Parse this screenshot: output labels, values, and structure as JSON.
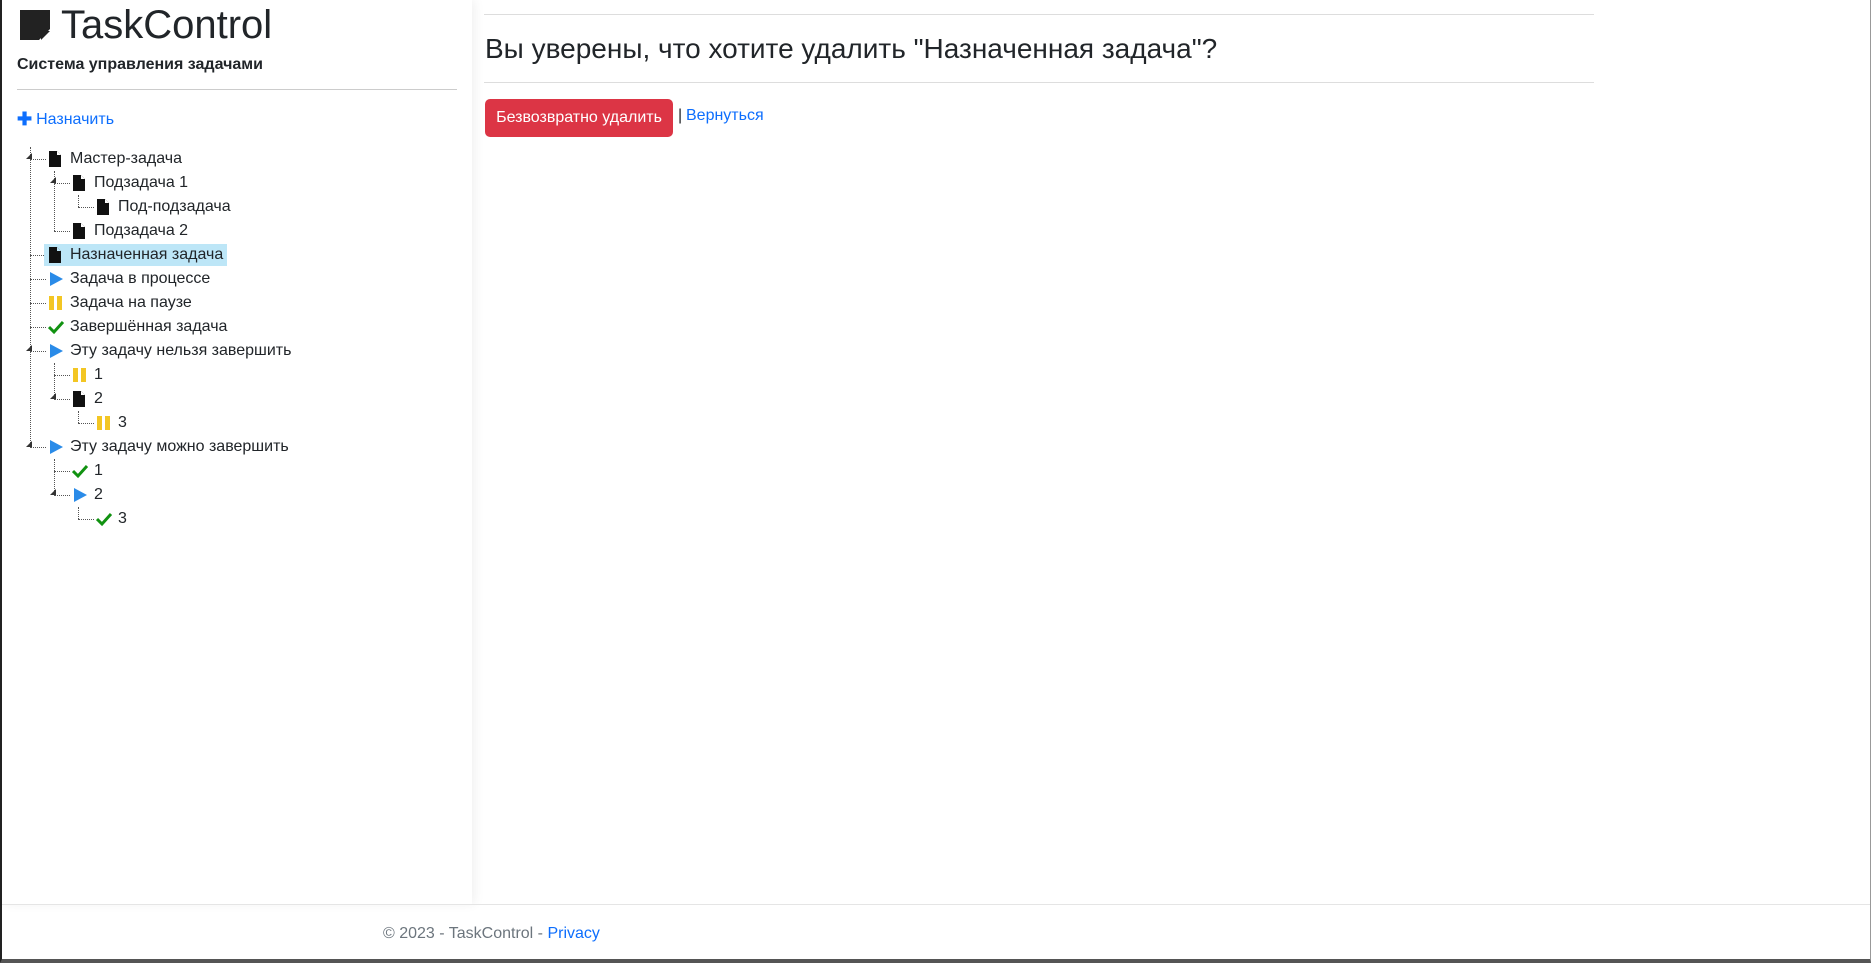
{
  "brand": {
    "title": "TaskControl",
    "subtitle": "Система управления задачами"
  },
  "sidebar": {
    "assign_label": "Назначить"
  },
  "tree": {
    "master": "Мастер-задача",
    "sub1": "Подзадача 1",
    "subsub": "Под-подзадача",
    "sub2": "Подзадача 2",
    "assigned": "Назначенная задача",
    "inprogress": "Задача в процессе",
    "paused": "Задача на паузе",
    "done": "Завершённая задача",
    "cannot": "Эту задачу нельзя завершить",
    "cannot_1": "1",
    "cannot_2": "2",
    "cannot_3": "3",
    "can": "Эту задачу можно завершить",
    "can_1": "1",
    "can_2": "2",
    "can_3": "3"
  },
  "main": {
    "title": "Вы уверены, что хотите удалить \"Назначенная задача\"?",
    "delete_label": "Безвозвратно удалить",
    "separator": "|",
    "back_label": "Вернуться"
  },
  "footer": {
    "copyright": "© 2023 - TaskControl - ",
    "privacy": "Privacy"
  },
  "colors": {
    "danger": "#dc3545",
    "link": "#0d6efd",
    "play": "#2a8be8",
    "pause": "#f3c623",
    "check": "#119211",
    "selected": "#bde6f7"
  }
}
